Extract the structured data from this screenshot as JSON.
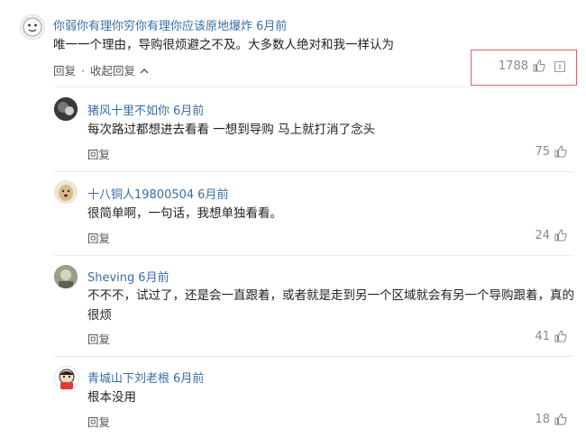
{
  "top_comment": {
    "username": "你弱你有理你穷你有理你应该原地爆炸",
    "time": "6月前",
    "text": "唯一一个理由，导购很烦避之不及。大多数人绝对和我一样认为",
    "reply_label": "回复",
    "separator": "·",
    "collapse_label": "收起回复",
    "collapse_icon": "chevron-up-icon",
    "likes": "1788",
    "accent_color": "#3a6ea5",
    "highlight_color": "#e06060"
  },
  "replies": [
    {
      "username": "猪风十里不如你",
      "time": "6月前",
      "text": "每次路过都想进去看看 一想到导购 马上就打消了念头",
      "reply_label": "回复",
      "likes": "75"
    },
    {
      "username": "十八铜人19800504",
      "time": "6月前",
      "text": "很简单啊，一句话，我想单独看看。",
      "reply_label": "回复",
      "likes": "24"
    },
    {
      "username": "Sheving",
      "time": "6月前",
      "text": "不不不，试过了，还是会一直跟着，或者就是走到另一个区域就会有另一个导购跟着，真的很烦",
      "reply_label": "回复",
      "likes": "41"
    },
    {
      "username": "青城山下刘老根",
      "time": "6月前",
      "text": "根本没用",
      "reply_label": "回复",
      "likes": "18"
    }
  ]
}
